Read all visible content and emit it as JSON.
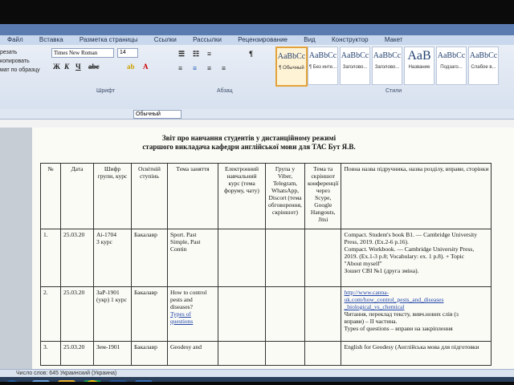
{
  "window": {
    "title": ""
  },
  "ribbon_tabs": [
    "Файл",
    "Вставка",
    "Разметка страницы",
    "Ссылки",
    "Рассылки",
    "Рецензирование",
    "Вид",
    "Конструктор",
    "Макет"
  ],
  "clipboard": {
    "cut": "резать",
    "copy": "копировать",
    "painter": "мат по образцу"
  },
  "font": {
    "family": "Times New Roman",
    "size": "14",
    "group_label": "Шрифт"
  },
  "paragraph": {
    "group_label": "Абзац"
  },
  "styles": {
    "group_label": "Стили",
    "items": [
      {
        "sample": "AaBbCc",
        "name": "¶ Обычный"
      },
      {
        "sample": "AaBbCc",
        "name": "¶ Без инте..."
      },
      {
        "sample": "AaBbCc",
        "name": "Заголово..."
      },
      {
        "sample": "AaBbCc",
        "name": "Заголово..."
      },
      {
        "sample": "AaB",
        "name": "Название"
      },
      {
        "sample": "AaBbCc",
        "name": "Подзаго..."
      },
      {
        "sample": "AaBbCc",
        "name": "Слабое в..."
      }
    ]
  },
  "quickbar": {
    "style_value": "Обычный"
  },
  "document": {
    "title_line1": "Звіт про навчання студентів у дистанційному режимі",
    "title_line2": "старшого викладача кафедри англійської мови для ТАС Бут Я.В.",
    "headers": {
      "num": "№",
      "date": "Дата",
      "group": "Шифр групи, курс",
      "level": "Освітній ступінь",
      "topic": "Тема заняття",
      "course": "Електронний навчальний курс (тема форуму, чату)",
      "viber": "Група у Viber, Telegram, WhatsApp, Discort (тема обговорення, скріншот)",
      "skype": "Тема та скріншот конференції через Scype, Google Hangouts, Jitsi",
      "textbook": "Повна назва підручника, назва розділу, вправи, сторінки"
    },
    "rows": [
      {
        "num": "1.",
        "date": "25.03.20",
        "group_code": "Аі-1704",
        "group_year": "3 курс",
        "level": "Бакалавр",
        "topic_lines": [
          "Sport. Past",
          "Simple, Past",
          "Contin"
        ],
        "textbook_lines": [
          "Compact. Student's book B1. — Cambridge University",
          "Press, 2019. (Ex.2-6 p.16).",
          "Compact. Workbook. — Cambridge University Press,",
          "2019. (Ex.1-3 p.8; Vocabulary: ex. 1 p.8). + Topic",
          "\"About myself\"",
          "Зошит СВІ №1 (друга зміна)."
        ]
      },
      {
        "num": "2.",
        "date": "25.03.20",
        "group_code": "ЗаР-1901",
        "group_year": "(укр) 1 курс",
        "level": "Бакалавр",
        "topic_lines": [
          "How to control",
          "pests and",
          "diseases?",
          "Types of",
          "questions"
        ],
        "textbook_link1": "http://www.canna-",
        "textbook_link2": "uk.com/how_control_pests_and_diseases",
        "textbook_link3": "_biological_vs_chemical",
        "textbook_lines": [
          "Читання, переклад тексту, вивч.нових слів (з",
          "вправи) – II частина.",
          "Types of questions – вправи на закріплення"
        ]
      },
      {
        "num": "3.",
        "date": "25.03.20",
        "group_code": "Зем-1901",
        "level": "Бакалавр",
        "topic_lines": [
          "Geodesy and"
        ],
        "textbook_lines": [
          "English for Geodesy (Англійська мова для підготовки"
        ]
      }
    ]
  },
  "status": {
    "text": "Число слов: 645     Украинский (Украина)"
  },
  "colors": {
    "titlebar": "#5a7bb0",
    "ribbon": "#dbe4f1",
    "taskbar": "#2a3f5c",
    "link": "#2145a8"
  }
}
